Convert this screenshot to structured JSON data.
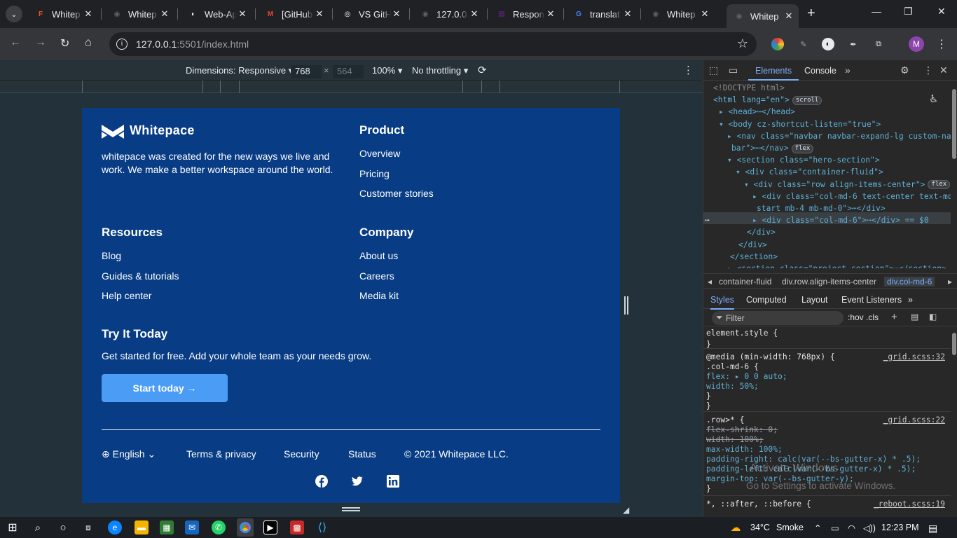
{
  "tabs": [
    {
      "title": "Whitep",
      "fav": "F",
      "color": "#f24e1e",
      "active": false
    },
    {
      "title": "Whitep",
      "fav": "◉",
      "color": "#5f6368",
      "active": false
    },
    {
      "title": "Web-Ap",
      "fav": "◐",
      "color": "#ffffff",
      "active": false
    },
    {
      "title": "[GitHub",
      "fav": "M",
      "color": "#ea4335",
      "active": false
    },
    {
      "title": "VS GitH",
      "fav": "◎",
      "color": "#ffffff",
      "active": false
    },
    {
      "title": "127.0.0.",
      "fav": "◉",
      "color": "#5f6368",
      "active": false
    },
    {
      "title": "Respon",
      "fav": "▤",
      "color": "#7b1fa2",
      "active": false
    },
    {
      "title": "translat",
      "fav": "G",
      "color": "#4285f4",
      "active": false
    },
    {
      "title": "Whitep",
      "fav": "◉",
      "color": "#5f6368",
      "active": false
    },
    {
      "title": "Whitep",
      "fav": "◉",
      "color": "#5f6368",
      "active": true
    }
  ],
  "address": {
    "host": "127.0.0.1",
    "path": ":5501/index.html"
  },
  "profile_initial": "M",
  "devbar": {
    "dimensions_label": "Dimensions: Responsive",
    "width": "768",
    "height": "564",
    "zoom": "100%",
    "throttling": "No throttling"
  },
  "site": {
    "brand": "Whitepace",
    "tagline": "whitepace was created for the new ways we live and work. We make a better workspace around the world.",
    "product": {
      "heading": "Product",
      "links": [
        "Overview",
        "Pricing",
        "Customer stories"
      ]
    },
    "resources": {
      "heading": "Resources",
      "links": [
        "Blog",
        "Guides & tutorials",
        "Help center"
      ]
    },
    "company": {
      "heading": "Company",
      "links": [
        "About us",
        "Careers",
        "Media kit"
      ]
    },
    "try_heading": "Try It Today",
    "try_sub": "Get started for free. Add your whole team as your needs grow.",
    "cta": "Start today →",
    "footer": {
      "language": "English",
      "terms": "Terms & privacy",
      "security": "Security",
      "status": "Status",
      "copyright": "2021 Whitepace LLC."
    }
  },
  "devtools": {
    "tab_elements": "Elements",
    "tab_console": "Console",
    "dom": [
      {
        "t": "<!DOCTYPE html>"
      },
      {
        "t": "<html lang=\"en\">",
        "pill": "scroll"
      },
      {
        "t": "▸ <head>⋯</head>"
      },
      {
        "t": "▾ <body cz-shortcut-listen=\"true\">"
      },
      {
        "t": "▸ <nav class=\"navbar navbar-expand-lg custom-nav"
      },
      {
        "t": "bar\">⋯</nav>",
        "pill": "flex"
      },
      {
        "t": "▾ <section class=\"hero-section\">"
      },
      {
        "t": "▾ <div class=\"container-fluid\">"
      },
      {
        "t": "▾ <div class=\"row align-items-center\">",
        "pill": "flex"
      },
      {
        "t": "▸ <div class=\"col-md-6 text-center text-md-"
      },
      {
        "t": "start mb-4 mb-md-0\">⋯</div>"
      },
      {
        "t": "▸ <div class=\"col-md-6\">⋯</div> == $0"
      },
      {
        "t": "</div>"
      },
      {
        "t": "</div>"
      },
      {
        "t": "</section>"
      },
      {
        "t": "▸ <section class=\"project-section\">⋯</section>"
      }
    ],
    "crumbs": [
      "container-fluid",
      "div.row.align-items-center",
      "div.col-md-6"
    ],
    "style_tabs": [
      "Styles",
      "Computed",
      "Layout",
      "Event Listeners"
    ],
    "filter_placeholder": "Filter",
    "filter_tools": ":hov  .cls",
    "rules": [
      {
        "t": "element.style {"
      },
      {
        "t": "}"
      },
      {
        "t": "@media (min-width: 768px) {",
        "src": "_grid.scss:32"
      },
      {
        "t": " .col-md-6 {"
      },
      {
        "t": "   flex: ▸ 0 0 auto;"
      },
      {
        "t": "   width: 50%;"
      },
      {
        "t": " }"
      },
      {
        "t": "}"
      },
      {
        "t": ".row>* {",
        "src": "_grid.scss:22"
      },
      {
        "t": "   flex-shrink: 0;",
        "strike": true
      },
      {
        "t": "   width: 100%;",
        "strike": true
      },
      {
        "t": "   max-width: 100%;"
      },
      {
        "t": "   padding-right: calc(var(--bs-gutter-x) * .5);"
      },
      {
        "t": "   padding-left: calc(var(--bs-gutter-x) * .5);"
      },
      {
        "t": "   margin-top: var(--bs-gutter-y);"
      },
      {
        "t": "}"
      },
      {
        "t": "*, ::after, ::before {",
        "src": "_reboot.scss:19"
      }
    ],
    "watermark_title": "Activate Windows",
    "watermark_sub": "Go to Settings to activate Windows."
  },
  "taskbar": {
    "temp": "34°C",
    "weather": "Smoke",
    "time": "12:23 PM"
  }
}
